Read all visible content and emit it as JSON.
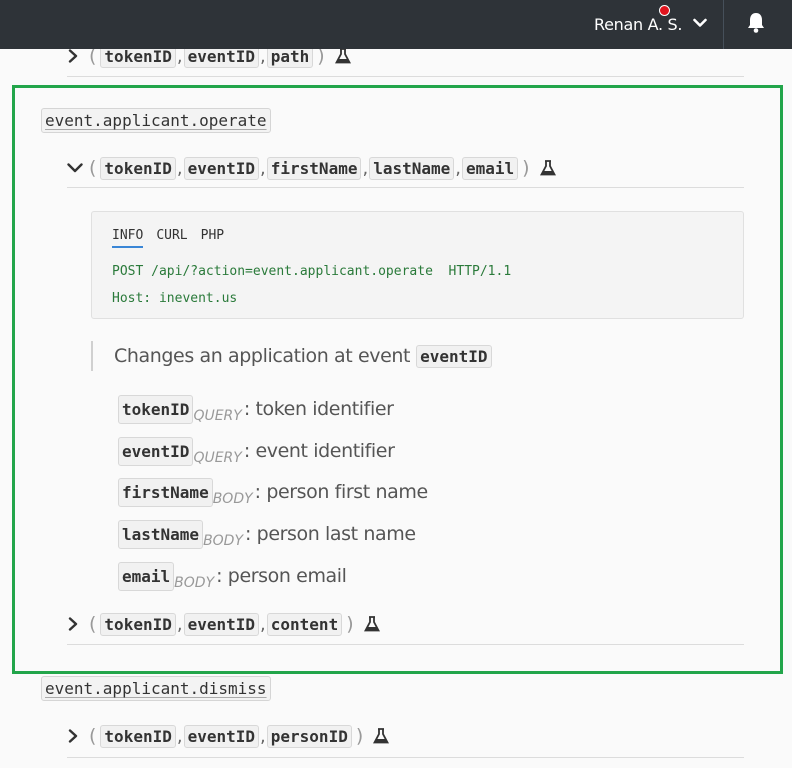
{
  "header": {
    "user_name": "Renan A. S.",
    "icons": [
      "chevron-down-icon",
      "bell-icon"
    ],
    "notification_dot_color": "#e0141e"
  },
  "top_signature": {
    "params": [
      "tokenID",
      "eventID",
      "path"
    ]
  },
  "operate": {
    "method": "event.applicant.operate",
    "signature": {
      "params": [
        "tokenID",
        "eventID",
        "firstName",
        "lastName",
        "email"
      ]
    },
    "code_tabs": [
      "INFO",
      "CURL",
      "PHP"
    ],
    "active_tab": "INFO",
    "request_line": "POST /api/?action=event.applicant.operate  HTTP/1.1",
    "host_line": "Host: inevent.us",
    "description_text": "Changes an application at event",
    "description_param": "eventID",
    "params": [
      {
        "name": "tokenID",
        "type": "QUERY",
        "desc": ": token identifier"
      },
      {
        "name": "eventID",
        "type": "QUERY",
        "desc": ": event identifier"
      },
      {
        "name": "firstName",
        "type": "BODY",
        "desc": ": person first name"
      },
      {
        "name": "lastName",
        "type": "BODY",
        "desc": ": person last name"
      },
      {
        "name": "email",
        "type": "BODY",
        "desc": ": person email"
      }
    ],
    "signature2": {
      "params": [
        "tokenID",
        "eventID",
        "content"
      ]
    }
  },
  "dismiss": {
    "method": "event.applicant.dismiss",
    "signature": {
      "params": [
        "tokenID",
        "eventID",
        "personID"
      ]
    }
  },
  "colors": {
    "highlight": "#22a54a",
    "topbar": "#2e3338",
    "tab_underline": "#3a86d6",
    "code_text": "#2a7a3a"
  }
}
